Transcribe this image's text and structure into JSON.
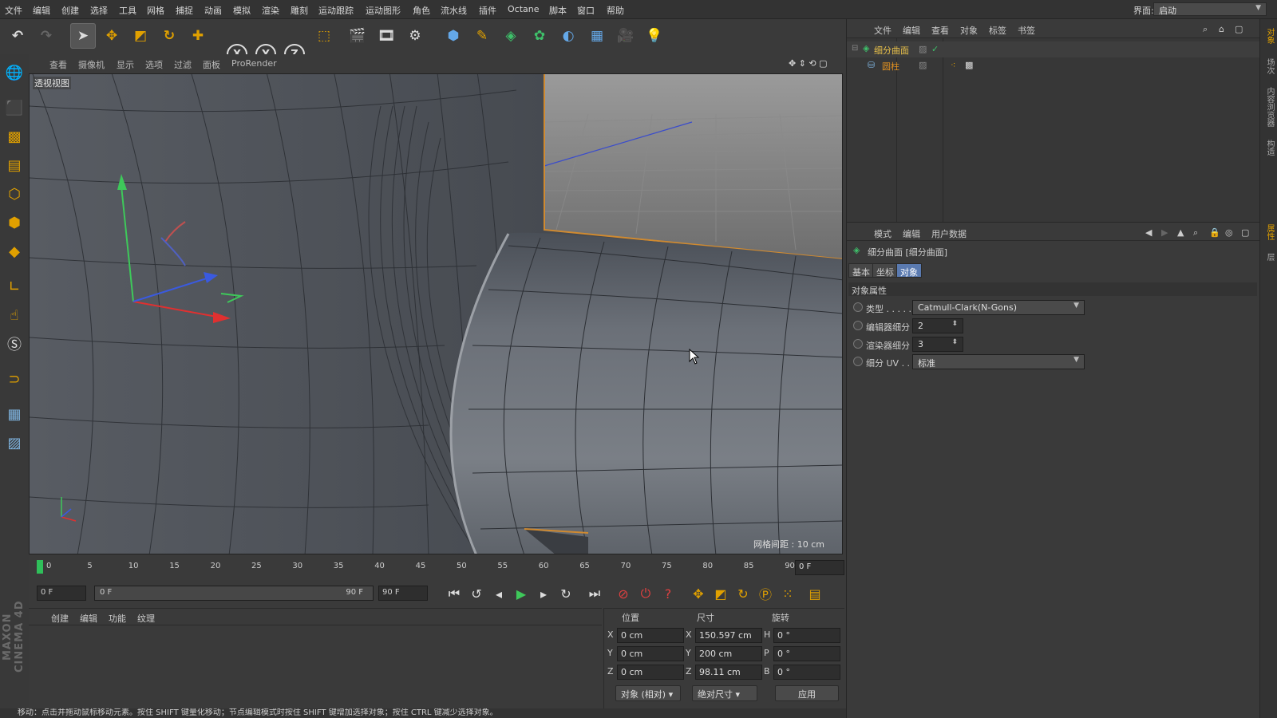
{
  "menubar": {
    "items": [
      "文件",
      "编辑",
      "创建",
      "选择",
      "工具",
      "网格",
      "捕捉",
      "动画",
      "模拟",
      "渲染",
      "雕刻",
      "运动跟踪",
      "运动图形",
      "角色",
      "流水线",
      "插件",
      "Octane",
      "脚本",
      "窗口",
      "帮助"
    ],
    "layout_label": "界面:",
    "layout_value": "启动"
  },
  "toolbar": {
    "icons": [
      "undo-icon",
      "redo-icon",
      "select-arrow-icon",
      "move-icon",
      "scale-icon",
      "rotate-icon",
      "live-select-icon",
      "x-axis-icon",
      "y-axis-icon",
      "z-axis-icon",
      "coordinate-system-icon",
      "render-view-icon",
      "render-picture-viewer-icon",
      "render-settings-icon",
      "cube-icon",
      "pen-icon",
      "subdivision-icon",
      "cloner-icon",
      "deformer-icon",
      "floor-icon",
      "camera-icon",
      "light-icon"
    ],
    "x": "X",
    "y": "Y",
    "z": "Z"
  },
  "viewport_menu": {
    "items": [
      "查看",
      "摄像机",
      "显示",
      "选项",
      "过滤",
      "面板",
      "ProRender"
    ],
    "title": "透视视图",
    "grid_label": "网格间距 : 10 cm"
  },
  "timeline": {
    "ticks": [
      "0",
      "5",
      "10",
      "15",
      "20",
      "25",
      "30",
      "35",
      "40",
      "45",
      "50",
      "55",
      "60",
      "65",
      "70",
      "75",
      "80",
      "85",
      "90"
    ],
    "current_frame": "0 F",
    "start_field": "0 F",
    "range_start": "0 F",
    "range_end": "90 F",
    "end_field": "90 F"
  },
  "material_panel": {
    "menu": [
      "创建",
      "编辑",
      "功能",
      "纹理"
    ]
  },
  "coord_panel": {
    "headers": [
      "位置",
      "尺寸",
      "旋转"
    ],
    "rows": [
      {
        "axis": "X",
        "pos": "0 cm",
        "size_axis": "X",
        "size": "150.597 cm",
        "rot_axis": "H",
        "rot": "0 °"
      },
      {
        "axis": "Y",
        "pos": "0 cm",
        "size_axis": "Y",
        "size": "200 cm",
        "rot_axis": "P",
        "rot": "0 °"
      },
      {
        "axis": "Z",
        "pos": "0 cm",
        "size_axis": "Z",
        "size": "98.11 cm",
        "rot_axis": "B",
        "rot": "0 °"
      }
    ],
    "mode_select": "对象 (相对)",
    "size_select": "绝对尺寸",
    "apply": "应用"
  },
  "status": "移动：点击并拖动鼠标移动元素。按住 SHIFT 键量化移动；节点编辑模式时按住 SHIFT 键增加选择对象；按住 CTRL 键减少选择对象。",
  "object_manager": {
    "menu": [
      "文件",
      "编辑",
      "查看",
      "对象",
      "标签",
      "书签"
    ],
    "objects": [
      {
        "name": "细分曲面",
        "color": "#e8c04a"
      },
      {
        "name": "圆柱",
        "color": "#e09020"
      }
    ]
  },
  "attribute_manager": {
    "menu": [
      "模式",
      "编辑",
      "用户数据"
    ],
    "title": "细分曲面 [细分曲面]",
    "tabs": [
      "基本",
      "坐标",
      "对象"
    ],
    "active_tab": 2,
    "section": "对象属性",
    "props": [
      {
        "label": "类型 . . . . .",
        "value": "Catmull-Clark(N-Gons)"
      },
      {
        "label": "编辑器细分",
        "value": "2"
      },
      {
        "label": "渲染器细分",
        "value": "3"
      },
      {
        "label": "细分 UV . .",
        "value": "标准"
      }
    ]
  },
  "side_tabs": [
    "对象",
    "场次",
    "内容浏览器",
    "构造",
    "属性",
    "层"
  ],
  "brand": "MAXON CINEMA 4D"
}
